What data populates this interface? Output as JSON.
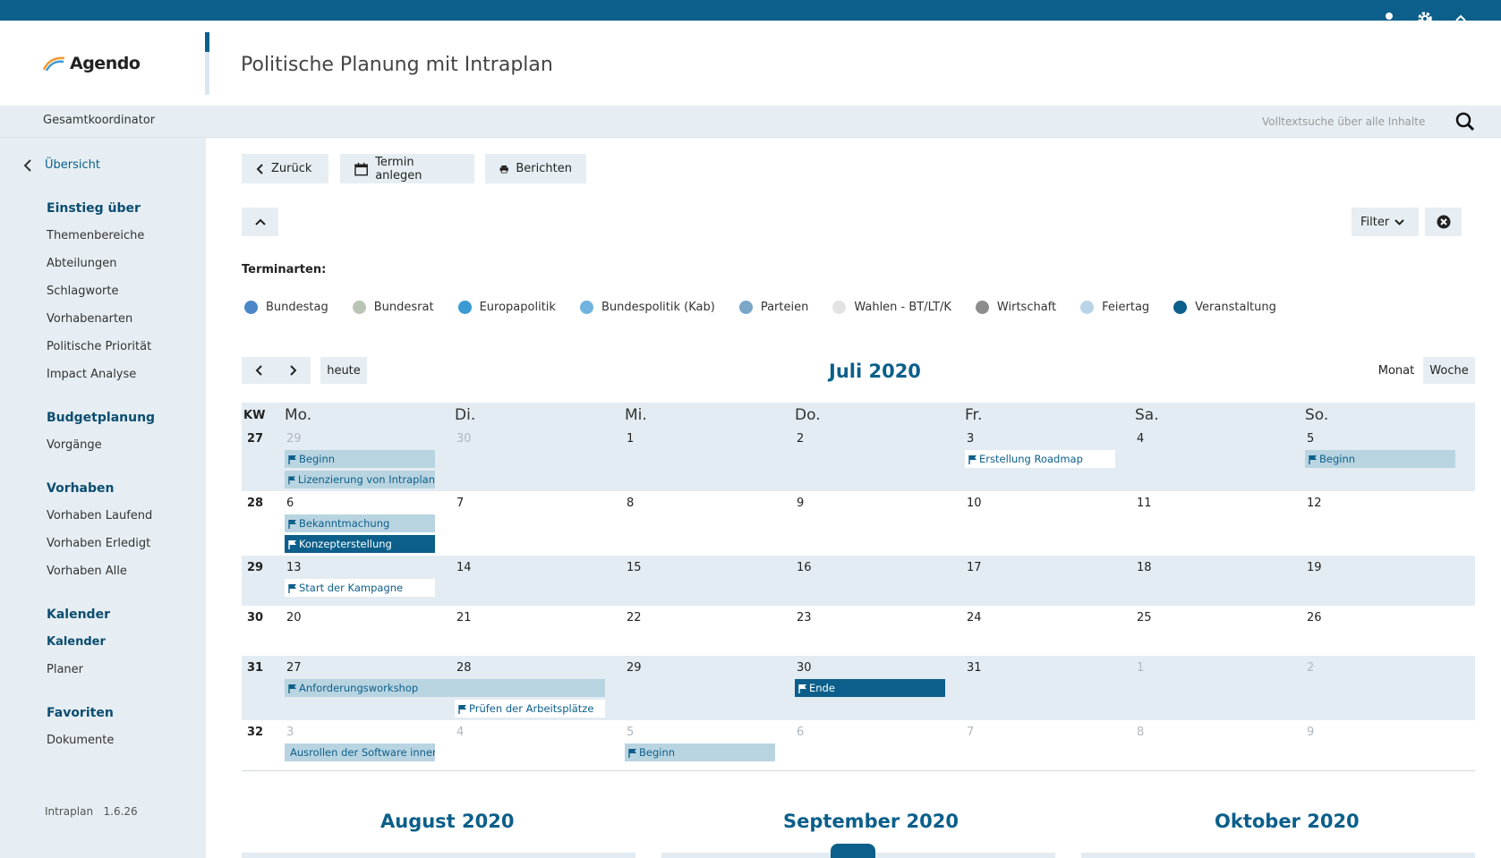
{
  "header": {
    "logo_text": "Agendo",
    "page_title": "Politische Planung mit Intraplan"
  },
  "subbar": {
    "role": "Gesamtkoordinator",
    "search_placeholder": "Volltextsuche über alle Inhalte"
  },
  "sidebar": {
    "back_label": "Übersicht",
    "groups": [
      {
        "title": "Einstieg über",
        "items": [
          "Themenbereiche",
          "Abteilungen",
          "Schlagworte",
          "Vorhabenarten",
          "Politische Priorität",
          "Impact Analyse"
        ]
      },
      {
        "title": "Budgetplanung",
        "items": [
          "Vorgänge"
        ]
      },
      {
        "title": "Vorhaben",
        "items": [
          "Vorhaben Laufend",
          "Vorhaben Erledigt",
          "Vorhaben Alle"
        ]
      },
      {
        "title": "Kalender",
        "items": [
          "Kalender",
          "Planer"
        ]
      },
      {
        "title": "Favoriten",
        "items": [
          "Dokumente"
        ]
      }
    ],
    "version": "Intraplan   1.6.26"
  },
  "toolbar": {
    "back": "Zurück",
    "create": "Termin anlegen",
    "report": "Berichten",
    "filter": "Filter"
  },
  "legend": {
    "title": "Terminarten:",
    "items": [
      {
        "label": "Bundestag",
        "color": "#4a86c8"
      },
      {
        "label": "Bundesrat",
        "color": "#b9c4b6"
      },
      {
        "label": "Europapolitik",
        "color": "#3a9ad2"
      },
      {
        "label": "Bundespolitik (Kab)",
        "color": "#6fb3de"
      },
      {
        "label": "Parteien",
        "color": "#7aa6c8"
      },
      {
        "label": "Wahlen - BT/LT/K",
        "color": "#e3e3e3"
      },
      {
        "label": "Wirtschaft",
        "color": "#8c8c8c"
      },
      {
        "label": "Feiertag",
        "color": "#b9d4e6"
      },
      {
        "label": "Veranstaltung",
        "color": "#0b5f8a"
      }
    ]
  },
  "calendar": {
    "today_label": "heute",
    "month_title": "Juli 2020",
    "view_month": "Monat",
    "view_week": "Woche",
    "kw_header": "KW",
    "day_headers": [
      "Mo.",
      "Di.",
      "Mi.",
      "Do.",
      "Fr.",
      "Sa.",
      "So."
    ],
    "weeks": [
      {
        "kw": "27",
        "days": [
          "29",
          "30",
          "1",
          "2",
          "3",
          "4",
          "5"
        ],
        "muted": [
          0,
          1
        ]
      },
      {
        "kw": "28",
        "days": [
          "6",
          "7",
          "8",
          "9",
          "10",
          "11",
          "12"
        ],
        "muted": []
      },
      {
        "kw": "29",
        "days": [
          "13",
          "14",
          "15",
          "16",
          "17",
          "18",
          "19"
        ],
        "muted": []
      },
      {
        "kw": "30",
        "days": [
          "20",
          "21",
          "22",
          "23",
          "24",
          "25",
          "26"
        ],
        "muted": []
      },
      {
        "kw": "31",
        "days": [
          "27",
          "28",
          "29",
          "30",
          "31",
          "1",
          "2"
        ],
        "muted": [
          5,
          6
        ]
      },
      {
        "kw": "32",
        "days": [
          "3",
          "4",
          "5",
          "6",
          "7",
          "8",
          "9"
        ],
        "muted": [
          0,
          1,
          2,
          3,
          4,
          5,
          6
        ]
      }
    ],
    "events": [
      {
        "week": 0,
        "col": 0,
        "span": 1,
        "row": 0,
        "label": "Beginn",
        "style": "light"
      },
      {
        "week": 0,
        "col": 0,
        "span": 1,
        "row": 1,
        "label": "Lizenzierung von Intraplan",
        "style": "light"
      },
      {
        "week": 0,
        "col": 4,
        "span": 1,
        "row": 0,
        "label": "Erstellung Roadmap",
        "style": "white"
      },
      {
        "week": 0,
        "col": 6,
        "span": 1,
        "row": 0,
        "label": "Beginn",
        "style": "light"
      },
      {
        "week": 1,
        "col": 0,
        "span": 1,
        "row": 0,
        "label": "Bekanntmachung",
        "style": "light"
      },
      {
        "week": 1,
        "col": 0,
        "span": 1,
        "row": 1,
        "label": "Konzepterstellung",
        "style": "dark"
      },
      {
        "week": 2,
        "col": 0,
        "span": 1,
        "row": 0,
        "label": "Start der Kampagne",
        "style": "white"
      },
      {
        "week": 4,
        "col": 0,
        "span": 2,
        "row": 0,
        "label": "Anforderungsworkshop",
        "style": "light"
      },
      {
        "week": 4,
        "col": 1,
        "span": 1,
        "row": 1,
        "label": "Prüfen der Arbeitsplätze",
        "style": "white"
      },
      {
        "week": 4,
        "col": 3,
        "span": 1,
        "row": 0,
        "label": "Ende",
        "style": "dark"
      },
      {
        "week": 5,
        "col": 0,
        "span": 1,
        "row": 0,
        "label": "Ausrollen der Software inner",
        "style": "light"
      },
      {
        "week": 5,
        "col": 2,
        "span": 1,
        "row": 0,
        "label": "Beginn",
        "style": "light"
      }
    ]
  },
  "mini_months": [
    "August 2020",
    "September 2020",
    "Oktober 2020"
  ]
}
